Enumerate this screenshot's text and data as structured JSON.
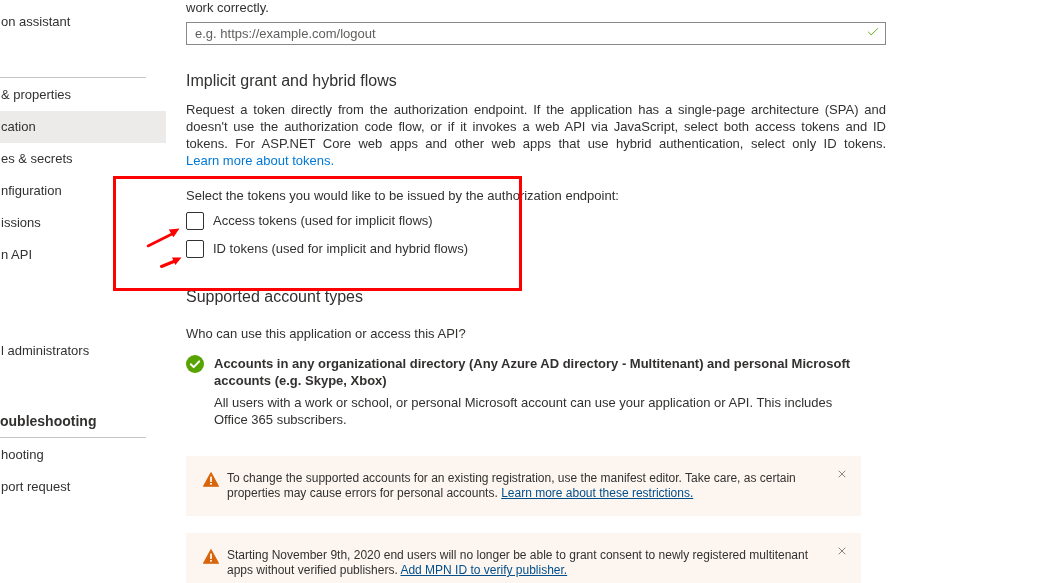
{
  "sidebar": {
    "top_items": [
      {
        "label": "on assistant",
        "selected": false
      }
    ],
    "sections": [
      {
        "items": [
          {
            "label": "& properties",
            "selected": false
          },
          {
            "label": "cation",
            "selected": true
          },
          {
            "label": "es & secrets",
            "selected": false
          },
          {
            "label": "nfiguration",
            "selected": false
          },
          {
            "label": "issions",
            "selected": false
          },
          {
            "label": "n API",
            "selected": false
          }
        ]
      },
      {
        "items": [
          {
            "label": "l administrators",
            "selected": false
          }
        ]
      },
      {
        "heading": "oubleshooting",
        "items": [
          {
            "label": "hooting",
            "selected": false
          },
          {
            "label": "port request",
            "selected": false
          }
        ]
      }
    ]
  },
  "logout_url": {
    "caption": "work correctly.",
    "placeholder": "e.g. https://example.com/logout",
    "valid": true
  },
  "implicit_grant": {
    "title": "Implicit grant and hybrid flows",
    "description": "Request a token directly from the authorization endpoint. If the application has a single-page architecture (SPA) and doesn't use the authorization code flow, or if it invokes a web API via JavaScript, select both access tokens and ID tokens. For ASP.NET Core web apps and other web apps that use hybrid authentication, select only ID tokens.",
    "link": "Learn more about tokens.",
    "prompt": "Select the tokens you would like to be issued by the authorization endpoint:",
    "options": [
      {
        "label": "Access tokens (used for implicit flows)",
        "checked": false
      },
      {
        "label": "ID tokens (used for implicit and hybrid flows)",
        "checked": false
      }
    ]
  },
  "supported_accounts": {
    "title": "Supported account types",
    "question": "Who can use this application or access this API?",
    "options": [
      {
        "label": "Accounts in any organizational directory (Any Azure AD directory - Multitenant) and personal Microsoft accounts (e.g. Skype, Xbox)",
        "description": "All users with a work or school, or personal Microsoft account can use your application or API. This includes Office 365 subscribers.",
        "selected": true
      }
    ]
  },
  "notices": [
    {
      "kind": "warning",
      "text": "To change the supported accounts for an existing registration, use the manifest editor. Take care, as certain properties may cause errors for personal accounts.",
      "link": "Learn more about these restrictions."
    },
    {
      "kind": "warning",
      "text": "Starting November 9th, 2020 end users will no longer be able to grant consent to newly registered multitenant apps without verified publishers.",
      "link": "Add MPN ID to verify publisher."
    }
  ]
}
